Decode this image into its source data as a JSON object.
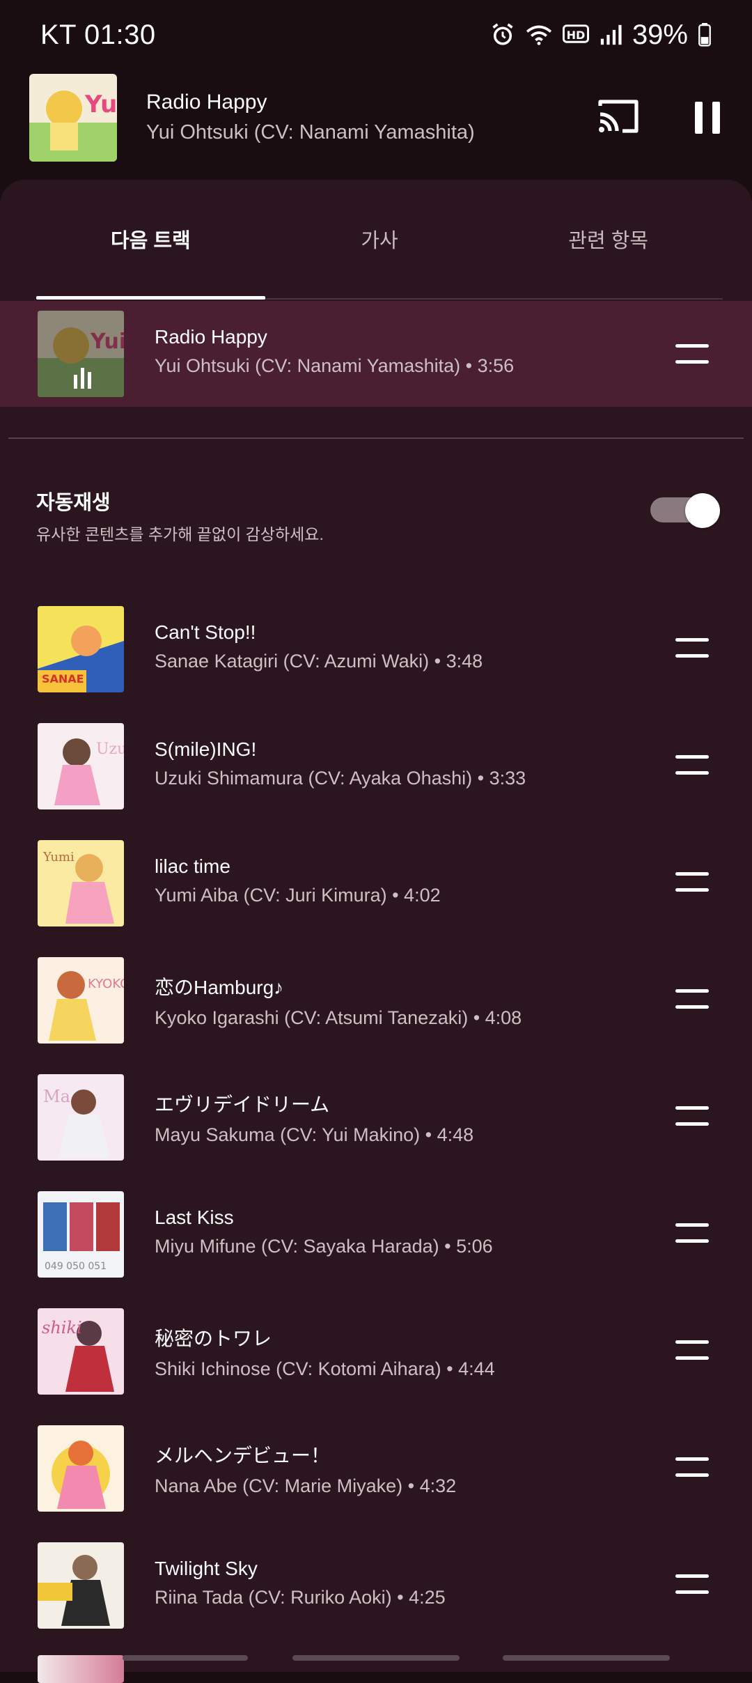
{
  "status_bar": {
    "carrier_time": "KT 01:30",
    "battery": "39%"
  },
  "mini_player": {
    "title": "Radio Happy",
    "artist": "Yui Ohtsuki (CV: Nanami Yamashita)"
  },
  "tabs": [
    {
      "label": "다음 트랙"
    },
    {
      "label": "가사"
    },
    {
      "label": "관련 항목"
    }
  ],
  "now_playing": {
    "title": "Radio Happy",
    "subtitle": "Yui Ohtsuki (CV: Nanami Yamashita) • 3:56"
  },
  "autoplay": {
    "title": "자동재생",
    "description": "유사한 콘텐츠를 추가해 끝없이 감상하세요.",
    "enabled": true
  },
  "queue": [
    {
      "title": "Can't Stop!!",
      "subtitle": "Sanae Katagiri (CV: Azumi Waki) • 3:48"
    },
    {
      "title": "S(mile)ING!",
      "subtitle": "Uzuki Shimamura (CV: Ayaka Ohashi) • 3:33"
    },
    {
      "title": "lilac time",
      "subtitle": "Yumi Aiba (CV: Juri Kimura) • 4:02"
    },
    {
      "title": "恋のHamburg♪",
      "subtitle": "Kyoko Igarashi (CV: Atsumi Tanezaki) • 4:08"
    },
    {
      "title": "エヴリデイドリーム",
      "subtitle": "Mayu Sakuma (CV: Yui Makino) • 4:48"
    },
    {
      "title": "Last Kiss",
      "subtitle": "Miyu Mifune (CV: Sayaka Harada) • 5:06"
    },
    {
      "title": "秘密のトワレ",
      "subtitle": "Shiki Ichinose (CV: Kotomi Aihara) • 4:44"
    },
    {
      "title": "メルヘンデビュー！",
      "subtitle": "Nana Abe (CV: Marie Miyake) • 4:32"
    },
    {
      "title": "Twilight Sky",
      "subtitle": "Riina Tada (CV: Ruriko Aoki) • 4:25"
    }
  ],
  "colors": {
    "background": "#1a0d12",
    "sheet": "#2b151f",
    "now_playing_highlight": "#4a1f31"
  }
}
